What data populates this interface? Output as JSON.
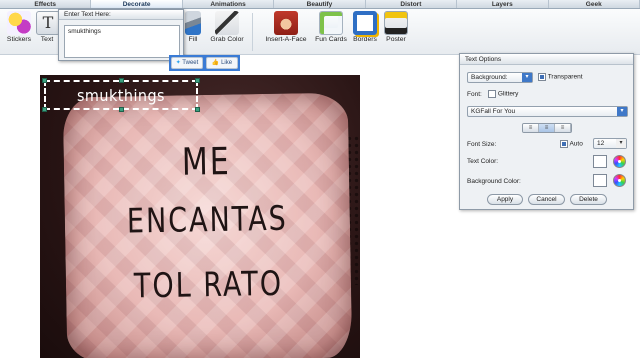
{
  "tabs": [
    {
      "label": "Effects",
      "active": false
    },
    {
      "label": "Decorate",
      "active": true
    },
    {
      "label": "Animations",
      "active": false
    },
    {
      "label": "Beautify",
      "active": false
    },
    {
      "label": "Distort",
      "active": false
    },
    {
      "label": "Layers",
      "active": false
    },
    {
      "label": "Geek",
      "active": false
    }
  ],
  "toolbar": {
    "stickers": "Stickers",
    "text": "Text",
    "fill": "Fill",
    "grab_color": "Grab Color",
    "insert_a_face": "Insert-A-Face",
    "fun_cards": "Fun Cards",
    "borders": "Borders",
    "poster": "Poster"
  },
  "entry": {
    "title": "Enter Text Here:",
    "value": "smukthings"
  },
  "social": {
    "tweet": "Tweet",
    "like": "Like"
  },
  "canvas": {
    "overlay_text": "smukthings",
    "pillow_lines": [
      "ME",
      "ENCANTAS",
      "TOL RATO"
    ]
  },
  "panel": {
    "title": "Text Options",
    "background_select": "Background:",
    "transparent_label": "Transparent",
    "transparent_checked": true,
    "font_label": "Font:",
    "glittery_label": "Glittery",
    "glittery_checked": false,
    "font_value": "KGFall For You",
    "font_size_label": "Font Size:",
    "auto_label": "Auto",
    "auto_checked": true,
    "font_size_value": "12",
    "text_color_label": "Text Color:",
    "bg_color_label": "Background Color:",
    "apply": "Apply",
    "cancel": "Cancel",
    "delete": "Delete"
  },
  "colors": {
    "accent": "#3f78c8",
    "overlay_text": "#ffffff",
    "selection_handle": "#3aa07f"
  }
}
